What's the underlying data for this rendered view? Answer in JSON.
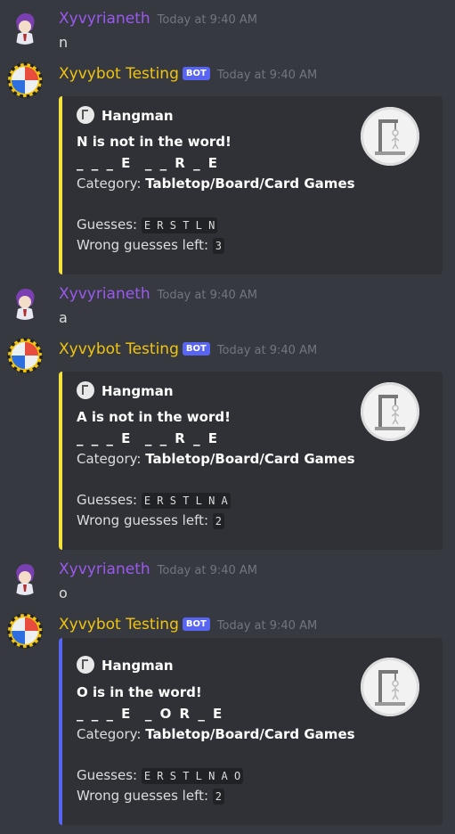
{
  "messages": [
    {
      "type": "user",
      "author": "Xyvyrianeth",
      "timestamp": "Today at 9:40 AM",
      "text": "n"
    },
    {
      "type": "bot",
      "author": "Xyvybot Testing",
      "badge": "BOT",
      "timestamp": "Today at 9:40 AM",
      "embed": {
        "color": "#f1e33b",
        "author": "Hangman",
        "title": "N is not in the word!",
        "word": "_ _ _ E  _ _ R _ E",
        "category_label": "Category: ",
        "category": "Tabletop/Board/Card Games",
        "guesses_label": "Guesses: ",
        "guesses": [
          "E",
          "R",
          "S",
          "T",
          "L",
          "N"
        ],
        "wrong_label": "Wrong guesses left: ",
        "wrong_left": "3",
        "thumbnail_icon": "hangman-icon"
      }
    },
    {
      "type": "user",
      "author": "Xyvyrianeth",
      "timestamp": "Today at 9:40 AM",
      "text": "a"
    },
    {
      "type": "bot",
      "author": "Xyvybot Testing",
      "badge": "BOT",
      "timestamp": "Today at 9:40 AM",
      "embed": {
        "color": "#f1e33b",
        "author": "Hangman",
        "title": "A is not in the word!",
        "word": "_ _ _ E  _ _ R _ E",
        "category_label": "Category: ",
        "category": "Tabletop/Board/Card Games",
        "guesses_label": "Guesses: ",
        "guesses": [
          "E",
          "R",
          "S",
          "T",
          "L",
          "N",
          "A"
        ],
        "wrong_label": "Wrong guesses left: ",
        "wrong_left": "2",
        "thumbnail_icon": "hangman-icon"
      }
    },
    {
      "type": "user",
      "author": "Xyvyrianeth",
      "timestamp": "Today at 9:40 AM",
      "text": "o"
    },
    {
      "type": "bot",
      "author": "Xyvybot Testing",
      "badge": "BOT",
      "timestamp": "Today at 9:40 AM",
      "embed": {
        "color": "#5865f2",
        "author": "Hangman",
        "title": "O is in the word!",
        "word": "_ _ _ E  _ O R _ E",
        "category_label": "Category: ",
        "category": "Tabletop/Board/Card Games",
        "guesses_label": "Guesses: ",
        "guesses": [
          "E",
          "R",
          "S",
          "T",
          "L",
          "N",
          "A",
          "O"
        ],
        "wrong_label": "Wrong guesses left: ",
        "wrong_left": "2",
        "thumbnail_icon": "hangman-icon"
      }
    }
  ],
  "colors": {
    "background": "#36393f",
    "user_name": "#9b59f0",
    "bot_name": "#f1c40f",
    "embed_bg": "#2f3136"
  }
}
